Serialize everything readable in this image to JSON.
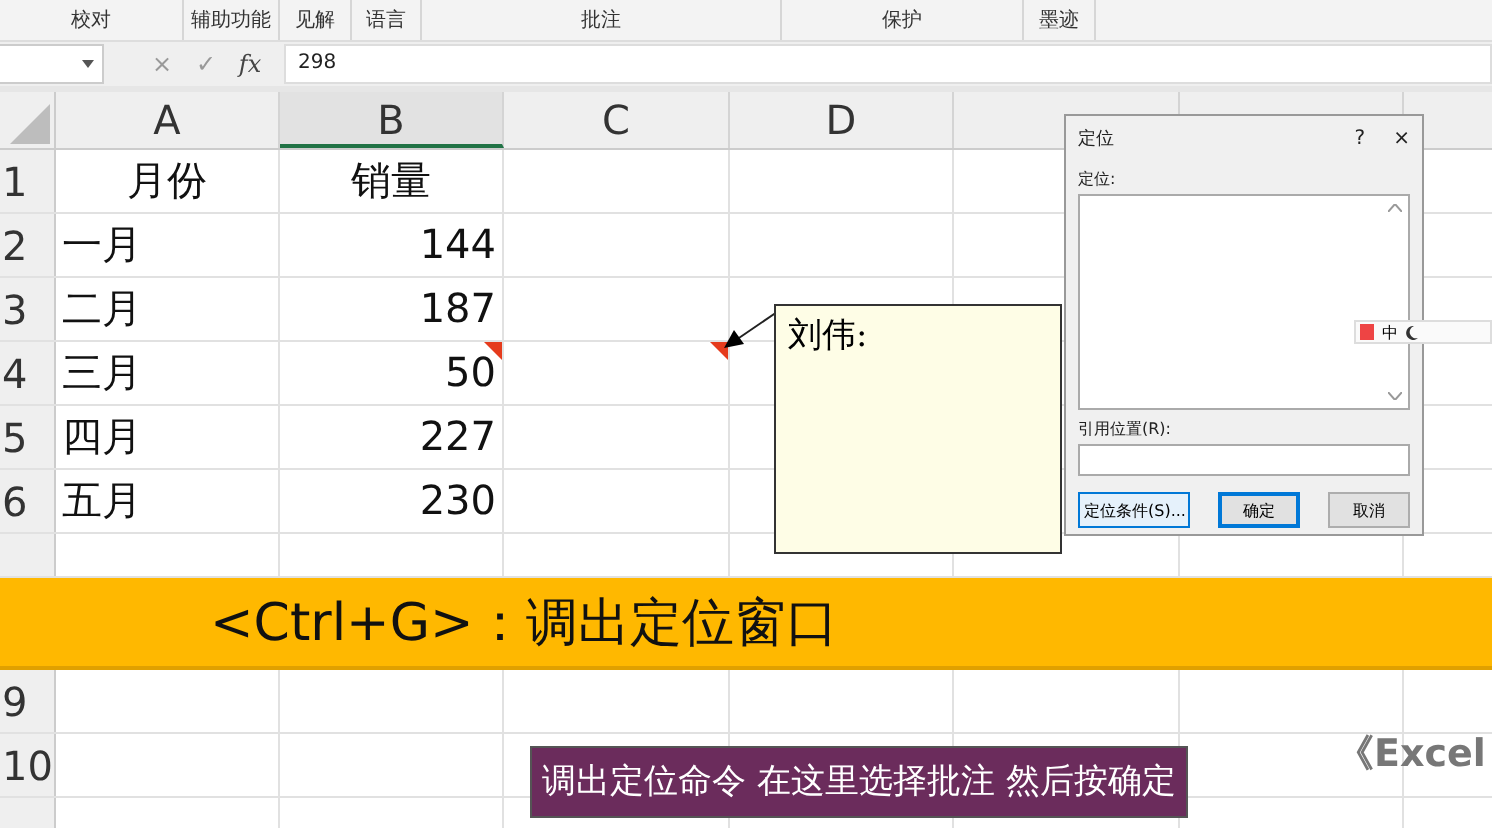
{
  "ribbon": {
    "groups": [
      {
        "label": "校对"
      },
      {
        "label": "辅助功能"
      },
      {
        "label": "见解"
      },
      {
        "label": "语言"
      },
      {
        "label": "批注"
      },
      {
        "label": "保护"
      },
      {
        "label": "墨迹"
      }
    ]
  },
  "formula_bar": {
    "cancel": "×",
    "enter": "✓",
    "fx": "fx",
    "value": "298"
  },
  "columns": [
    "A",
    "B",
    "C",
    "D"
  ],
  "rows": [
    {
      "number": "1",
      "kind": "header",
      "cells": [
        {
          "text": "月份",
          "comment": false
        },
        {
          "text": "销量",
          "comment": false
        }
      ]
    },
    {
      "number": "2",
      "kind": "data",
      "cells": [
        {
          "text": "一月",
          "comment": false
        },
        {
          "text": "144",
          "comment": false
        }
      ]
    },
    {
      "number": "3",
      "kind": "data",
      "cells": [
        {
          "text": "二月",
          "comment": false
        },
        {
          "text": "187",
          "comment": false
        }
      ]
    },
    {
      "number": "4",
      "kind": "data",
      "cells": [
        {
          "text": "三月",
          "comment": false
        },
        {
          "text": "50",
          "comment": true
        },
        {
          "comment": true
        }
      ]
    },
    {
      "number": "5",
      "kind": "data",
      "cells": [
        {
          "text": "四月",
          "comment": false
        },
        {
          "text": "227",
          "comment": false
        }
      ]
    },
    {
      "number": "6",
      "kind": "data",
      "cells": [
        {
          "text": "五月",
          "comment": false
        },
        {
          "text": "230",
          "comment": false
        }
      ]
    }
  ],
  "banner": {
    "text": "<Ctrl+G>：调出定位窗口"
  },
  "lower_rows": [
    {
      "number": "9"
    },
    {
      "number": "10"
    },
    {}
  ],
  "comment": {
    "author": "刘伟:"
  },
  "dialog": {
    "title": "定位",
    "help": "?",
    "close": "×",
    "list_label": "定位:",
    "reference_label": "引用位置(R):",
    "buttons": [
      {
        "label": "定位条件(S)...",
        "kind": "special"
      },
      {
        "label": "确定",
        "kind": "default"
      },
      {
        "label": "取消",
        "kind": "normal"
      }
    ]
  },
  "ime_toolbar": {
    "mode": "中"
  },
  "subtitle": "调出定位命令 在这里选择批注 然后按确定",
  "watermark_text": "《Excel"
}
